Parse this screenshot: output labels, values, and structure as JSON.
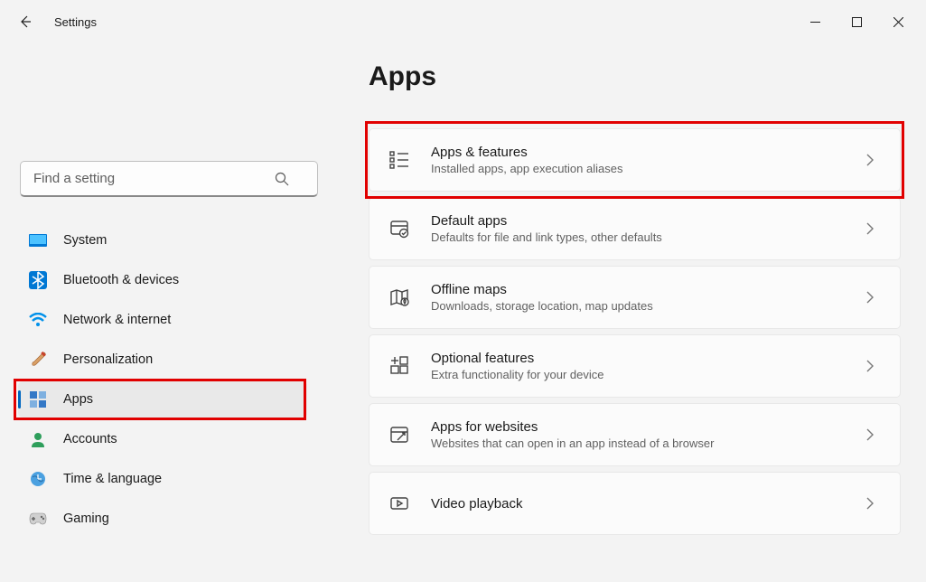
{
  "window": {
    "title": "Settings"
  },
  "search": {
    "placeholder": "Find a setting"
  },
  "sidebar": {
    "items": [
      {
        "label": "System"
      },
      {
        "label": "Bluetooth & devices"
      },
      {
        "label": "Network & internet"
      },
      {
        "label": "Personalization"
      },
      {
        "label": "Apps"
      },
      {
        "label": "Accounts"
      },
      {
        "label": "Time & language"
      },
      {
        "label": "Gaming"
      }
    ],
    "active_index": 4
  },
  "page": {
    "title": "Apps"
  },
  "cards": [
    {
      "title": "Apps & features",
      "subtitle": "Installed apps, app execution aliases"
    },
    {
      "title": "Default apps",
      "subtitle": "Defaults for file and link types, other defaults"
    },
    {
      "title": "Offline maps",
      "subtitle": "Downloads, storage location, map updates"
    },
    {
      "title": "Optional features",
      "subtitle": "Extra functionality for your device"
    },
    {
      "title": "Apps for websites",
      "subtitle": "Websites that can open in an app instead of a browser"
    },
    {
      "title": "Video playback",
      "subtitle": ""
    }
  ],
  "highlight_sidebar_index": 4,
  "highlight_card_index": 0
}
